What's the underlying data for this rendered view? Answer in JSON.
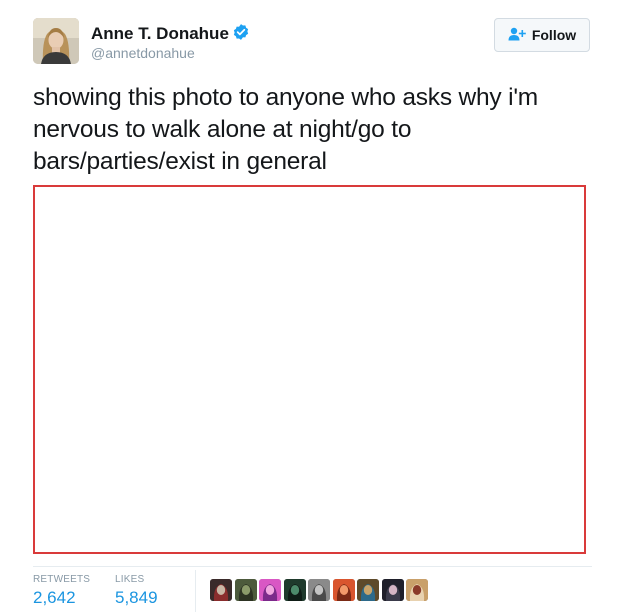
{
  "author": {
    "name": "Anne T. Donahue",
    "handle": "@annetdonahue",
    "verified_color": "#1da1f2"
  },
  "follow_button": {
    "label": "Follow",
    "icon": "add-person-icon"
  },
  "tweet": {
    "text": "showing this photo to anyone who asks why i'm nervous to walk alone at night/go to bars/parties/exist in general"
  },
  "media": {
    "border_color": "#d93a3a"
  },
  "stats": {
    "retweets_label": "RETWEETS",
    "retweets_value": "2,642",
    "likes_label": "LIKES",
    "likes_value": "5,849"
  },
  "likers": [
    {
      "name": "liker-1",
      "palette": [
        "#3a2a2a",
        "#c9b7a6",
        "#8a2d2d"
      ]
    },
    {
      "name": "liker-2",
      "palette": [
        "#4d5a3c",
        "#8b9a6a",
        "#2d3323"
      ]
    },
    {
      "name": "liker-3",
      "palette": [
        "#d957c4",
        "#f2a6e0",
        "#7b2a8a"
      ]
    },
    {
      "name": "liker-4",
      "palette": [
        "#1f3a2c",
        "#4c8a6a",
        "#0f1d16"
      ]
    },
    {
      "name": "liker-5",
      "palette": [
        "#8a8a8a",
        "#c4c4c4",
        "#4a4a4a"
      ]
    },
    {
      "name": "liker-6",
      "palette": [
        "#d9552e",
        "#f29a6a",
        "#7a2a15"
      ]
    },
    {
      "name": "liker-7",
      "palette": [
        "#5e4a2a",
        "#c9a46a",
        "#2d6a8a"
      ]
    },
    {
      "name": "liker-8",
      "palette": [
        "#1f1f2a",
        "#d4b4c4",
        "#3a3a4a"
      ]
    },
    {
      "name": "liker-9",
      "palette": [
        "#c9a06a",
        "#8a3a2a",
        "#e8d2b0"
      ]
    }
  ]
}
